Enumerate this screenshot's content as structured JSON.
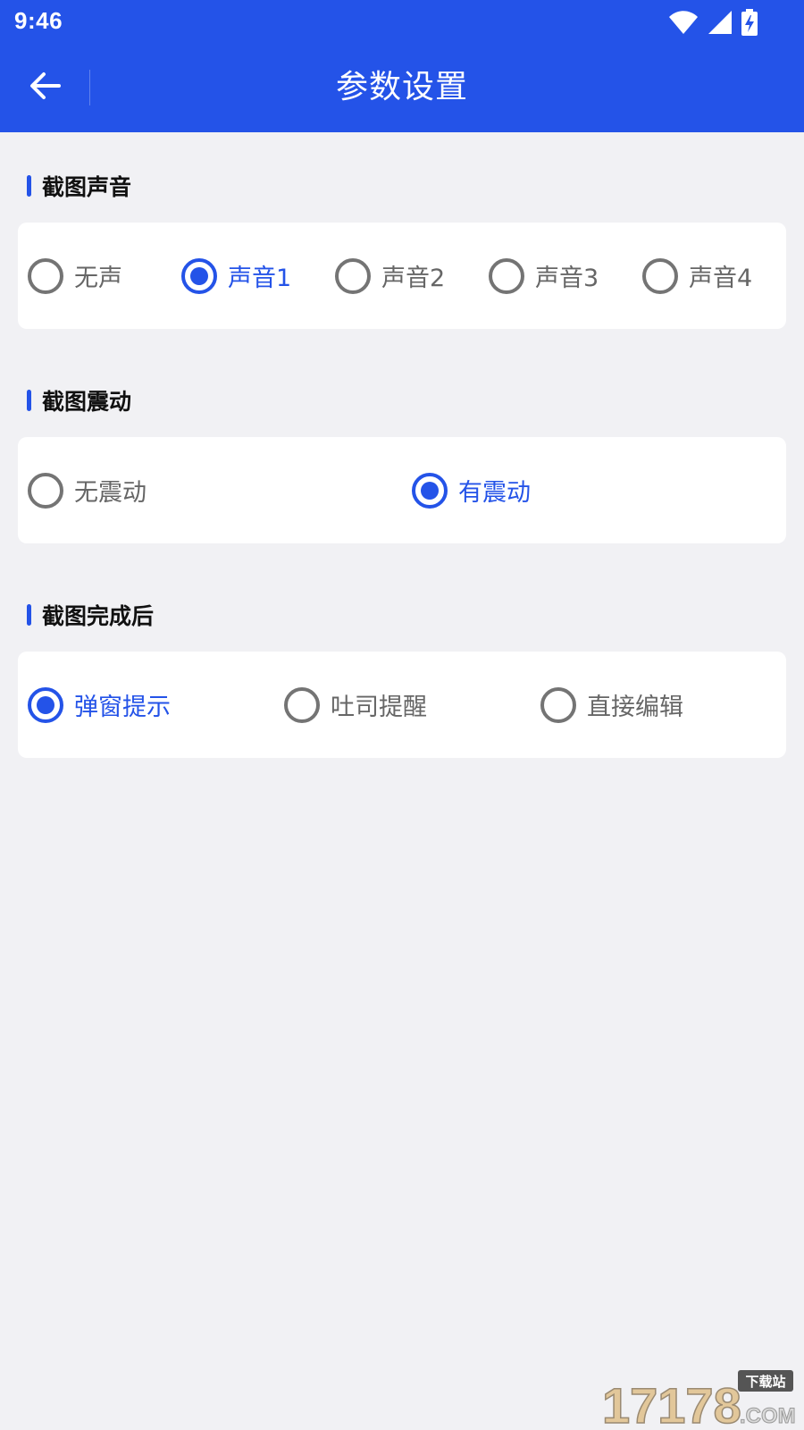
{
  "status_bar": {
    "time": "9:46",
    "icons": [
      "wifi-icon",
      "cellular-signal-icon",
      "battery-charging-icon"
    ]
  },
  "header": {
    "title": "参数设置",
    "back_icon": "back-arrow-icon"
  },
  "colors": {
    "accent": "#2453e8",
    "background": "#f1f1f4",
    "card": "#ffffff",
    "text_unselected": "#666666",
    "radio_unselected": "#747474"
  },
  "sections": [
    {
      "title": "截图声音",
      "options": [
        {
          "label": "无声",
          "selected": false
        },
        {
          "label": "声音1",
          "selected": true
        },
        {
          "label": "声音2",
          "selected": false
        },
        {
          "label": "声音3",
          "selected": false
        },
        {
          "label": "声音4",
          "selected": false
        }
      ]
    },
    {
      "title": "截图震动",
      "options": [
        {
          "label": "无震动",
          "selected": false
        },
        {
          "label": "有震动",
          "selected": true
        }
      ]
    },
    {
      "title": "截图完成后",
      "options": [
        {
          "label": "弹窗提示",
          "selected": true
        },
        {
          "label": "吐司提醒",
          "selected": false
        },
        {
          "label": "直接编辑",
          "selected": false
        }
      ]
    }
  ],
  "watermark": {
    "number": "17178",
    "caption": "下载站",
    "suffix": ".COM"
  }
}
